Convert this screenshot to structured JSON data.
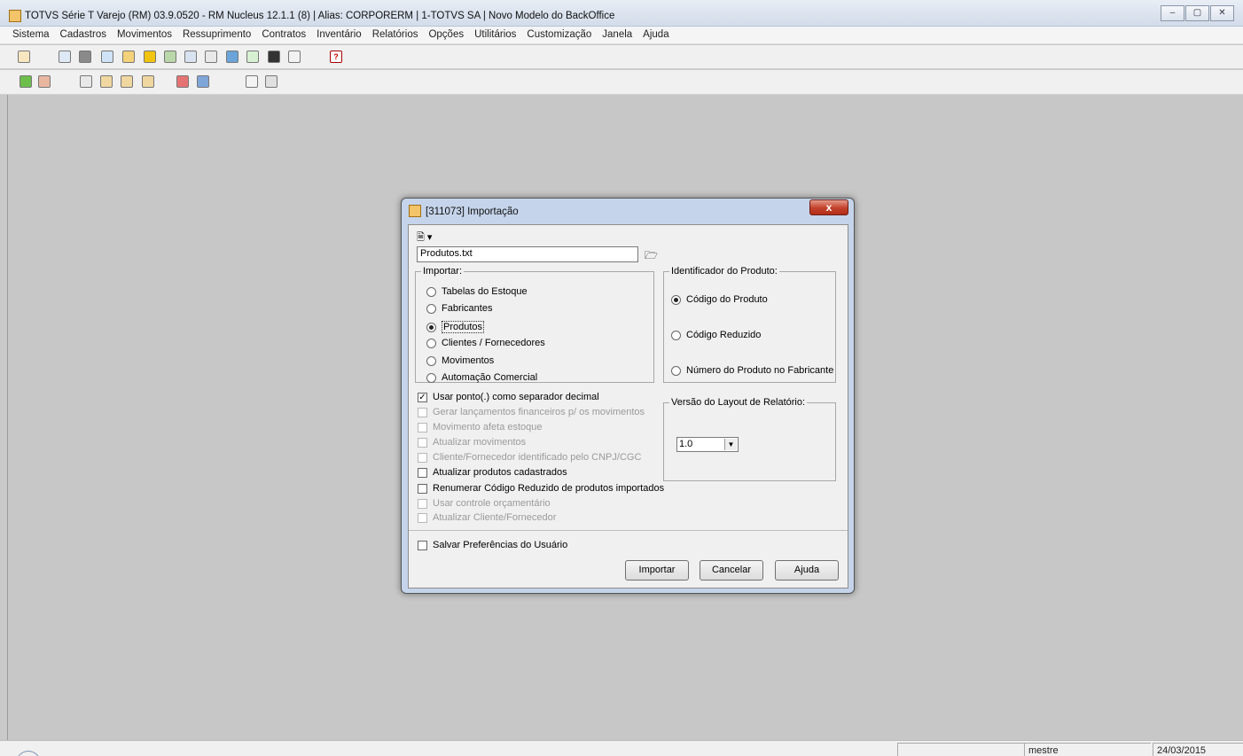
{
  "window": {
    "title": "TOTVS Série T Varejo (RM) 03.9.0520 - RM Nucleus 12.1.1 (8) | Alias: CORPORERM | 1-TOTVS SA | Novo Modelo do BackOffice",
    "buttons": {
      "minimize": "–",
      "restore": "▢",
      "close": "✕"
    }
  },
  "menu": [
    "Sistema",
    "Cadastros",
    "Movimentos",
    "Ressuprimento",
    "Contratos",
    "Inventário",
    "Relatórios",
    "Opções",
    "Utilitários",
    "Customização",
    "Janela",
    "Ajuda"
  ],
  "toolbar": {
    "help_glyph": "?"
  },
  "dialog": {
    "title": "[311073]  Importação",
    "close_glyph": "x",
    "new_menu_glyph": "🗎 ▾",
    "file_value": "Produtos.txt",
    "browse_glyph": "🗁",
    "importar": {
      "legend": "Importar:",
      "options": [
        "Tabelas do Estoque",
        "Fabricantes",
        "Produtos",
        "Clientes / Fornecedores",
        "Movimentos",
        "Automação Comercial"
      ],
      "selected": 2
    },
    "identificador": {
      "legend": "Identificador do Produto:",
      "options": [
        "Código do Produto",
        "Código Reduzido",
        "Número do Produto no Fabricante"
      ],
      "selected": 0
    },
    "versao": {
      "legend": "Versão do Layout de Relatório:",
      "value": "1.0"
    },
    "checkboxes": [
      {
        "label": "Usar ponto(.) como separador decimal",
        "checked": true,
        "enabled": true
      },
      {
        "label": "Gerar lançamentos financeiros p/ os movimentos",
        "checked": false,
        "enabled": false
      },
      {
        "label": "Movimento afeta estoque",
        "checked": false,
        "enabled": false
      },
      {
        "label": "Atualizar movimentos",
        "checked": false,
        "enabled": false
      },
      {
        "label": "Cliente/Fornecedor identificado pelo CNPJ/CGC",
        "checked": false,
        "enabled": false
      },
      {
        "label": "Atualizar produtos cadastrados",
        "checked": false,
        "enabled": true
      },
      {
        "label": "Renumerar Código Reduzido de produtos importados",
        "checked": false,
        "enabled": true
      },
      {
        "label": "Usar controle orçamentário",
        "checked": false,
        "enabled": false
      },
      {
        "label": "Atualizar Cliente/Fornecedor",
        "checked": false,
        "enabled": false
      }
    ],
    "salvar_pref": "Salvar Preferências do Usuário",
    "buttons": {
      "importar": "Importar",
      "cancelar": "Cancelar",
      "ajuda": "Ajuda"
    }
  },
  "status": {
    "user": "mestre",
    "date": "24/03/2015"
  }
}
